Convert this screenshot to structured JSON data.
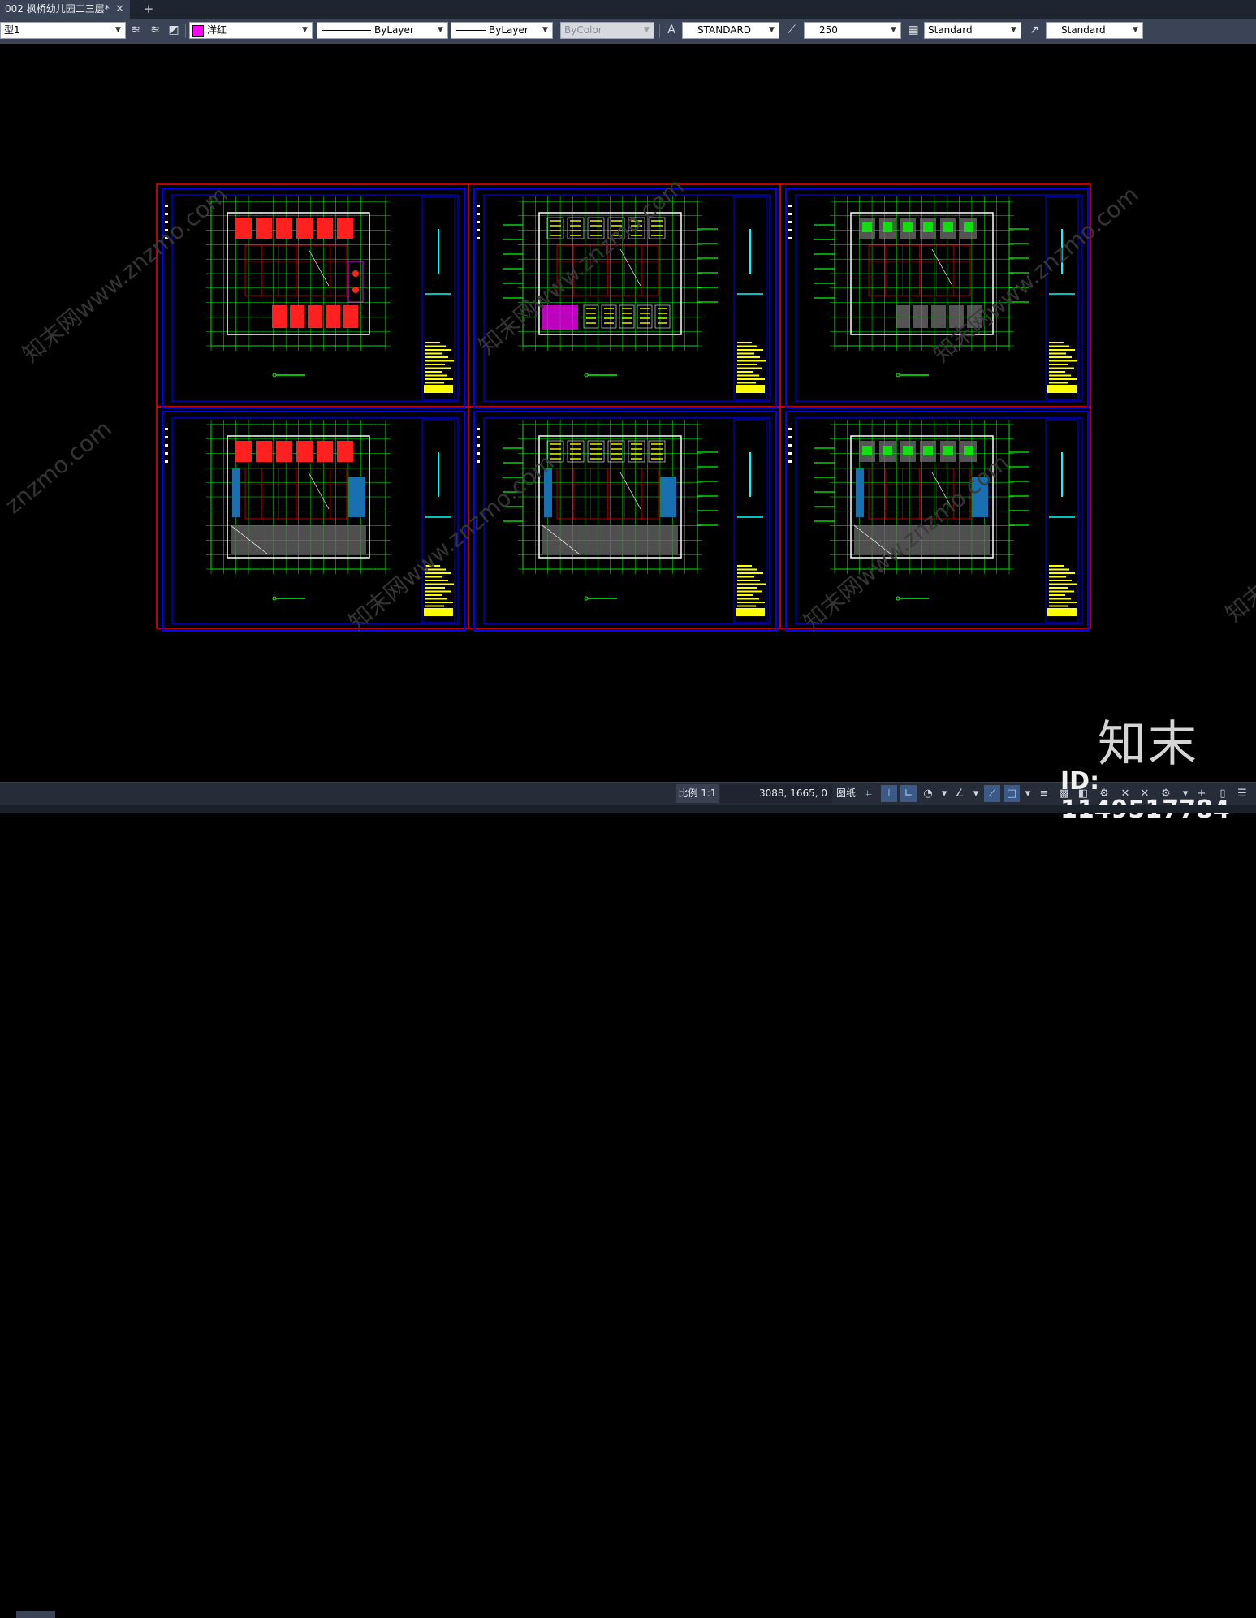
{
  "tab": {
    "title": "002 枫桥幼儿园二三层*",
    "close": "✕",
    "new": "+"
  },
  "toolbar": {
    "layer": "型1",
    "color": "洋红",
    "color_hex": "#ff00ff",
    "linetype": "ByLayer",
    "lineweight": "ByLayer",
    "plotstyle": "ByColor",
    "textstyle": "STANDARD",
    "dimscale": "250",
    "tablestyle": "Standard",
    "mleaderstyle": "Standard"
  },
  "status": {
    "scale": "比例 1:1",
    "coords": "3088, 1665, 0",
    "paper": "图纸"
  },
  "watermark": {
    "brand": "知末",
    "id": "ID: 1149517784",
    "diagonal": [
      "知末网www.znzmo.com",
      "知末网www.znzmo.com",
      "知末网www.znzmo.com",
      "znzmo.com",
      "知末网www.znzmo.com",
      "知末网www.znzmo.com",
      "知末网"
    ]
  },
  "colors": {
    "bg": "#000000",
    "border_red": "#ff0000",
    "frame_blue": "#0000ff",
    "plan_green": "#00ff00",
    "title_yellow": "#ffff00",
    "furniture_red": "#ff2020",
    "cyan": "#00ffff",
    "magenta": "#ff00ff"
  },
  "sheets": [
    {
      "row": 0,
      "col": 0,
      "variant": "furniture"
    },
    {
      "row": 0,
      "col": 1,
      "variant": "ceiling"
    },
    {
      "row": 0,
      "col": 2,
      "variant": "dims"
    },
    {
      "row": 1,
      "col": 0,
      "variant": "furniture-lower"
    },
    {
      "row": 1,
      "col": 1,
      "variant": "ceiling-lower"
    },
    {
      "row": 1,
      "col": 2,
      "variant": "dims-lower"
    }
  ],
  "icons": [
    "layer-properties-icon",
    "layer-match-icon",
    "layer-previous-icon",
    "text-style-icon",
    "dim-style-icon",
    "table-style-icon",
    "mleader-style-icon"
  ]
}
